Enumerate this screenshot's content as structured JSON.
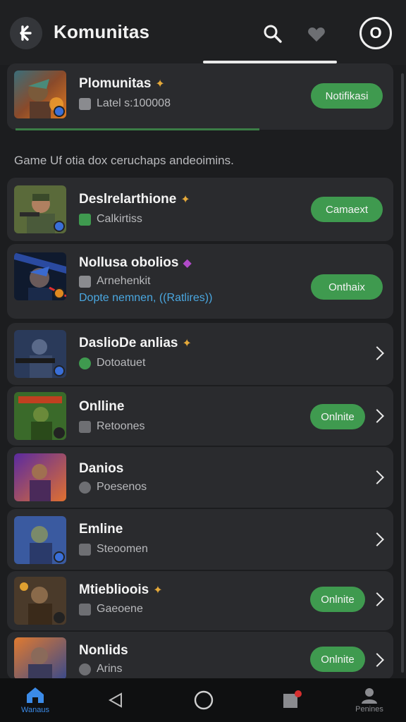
{
  "header": {
    "title": "Komunitas",
    "profile_label": "O"
  },
  "description": "Game Uf otia dox ceruchaps andeoimins.",
  "featured": {
    "name": "Plomunitas",
    "status": "Latel s:100008",
    "action": "Notifikasi"
  },
  "items": [
    {
      "name": "Deslrelarthione",
      "status": "Calkirtiss",
      "action": "Camaext"
    },
    {
      "name": "Nollusa obolios",
      "status": "Arnehenkit",
      "extra": "Dopte nemnen, ((Ratlires))",
      "action": "Onthaix"
    },
    {
      "name": "DaslioDe anlias",
      "status": "Dotoatuet"
    },
    {
      "name": "Onlline",
      "status": "Retoones",
      "action": "Onlnite"
    },
    {
      "name": "Danios",
      "status": "Poesenos"
    },
    {
      "name": "Emline",
      "status": "Steoomen"
    },
    {
      "name": "Mtieblioois",
      "status": "Gaeoene",
      "action": "Onlnite"
    },
    {
      "name": "Nonlids",
      "status": "Arins",
      "action": "Onlnite"
    }
  ],
  "bottom_nav": {
    "home": "Wanaus",
    "profile": "Penines"
  },
  "colors": {
    "accent": "#3f9a4f",
    "background": "#1c1d1f",
    "card": "#2a2b2e"
  }
}
